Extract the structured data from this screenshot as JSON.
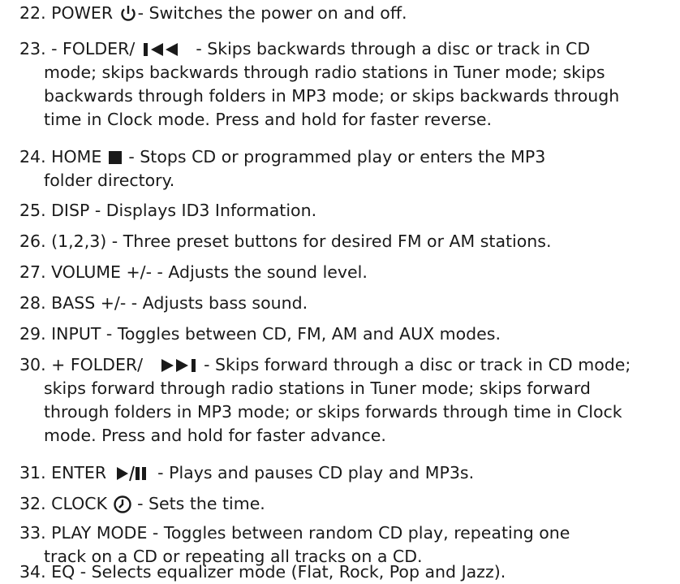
{
  "items": [
    {
      "num": "22.",
      "pre": " POWER ",
      "post": "- Switches the power on and off.",
      "icon": "power-icon"
    },
    {
      "num": "23.",
      "pre": " - FOLDER/ ",
      "post": " - Skips backwards through a disc or track in CD",
      "icon": "skip-back-icon",
      "cont": [
        "mode; skips backwards through radio stations in Tuner mode; skips",
        "backwards through folders in MP3 mode; or skips backwards through",
        "time in Clock mode.  Press and hold for faster reverse."
      ]
    },
    {
      "num": "24.",
      "pre": " HOME ",
      "post": " - Stops CD or programmed play or enters the MP3",
      "icon": "stop-square-icon",
      "cont": [
        "folder directory."
      ]
    },
    {
      "num": "25.",
      "text": " DISP - Displays ID3 Information."
    },
    {
      "num": "26.",
      "text": " (1,2,3) - Three preset buttons for desired FM or AM stations."
    },
    {
      "num": "27.",
      "text": " VOLUME +/- - Adjusts the sound level."
    },
    {
      "num": "28.",
      "text": " BASS +/- - Adjusts bass sound."
    },
    {
      "num": "29.",
      "text": " INPUT - Toggles between CD, FM, AM and AUX modes."
    },
    {
      "num": "30.",
      "pre": " + FOLDER/ ",
      "post": " - Skips forward through a disc or track in CD mode;",
      "icon": "skip-forward-icon",
      "cont": [
        "skips forward through radio stations in Tuner mode; skips forward",
        "through folders in MP3 mode; or skips forwards through time in Clock",
        "mode.  Press and hold for faster advance."
      ]
    },
    {
      "num": "31.",
      "pre": " ENTER ",
      "post": " - Plays and pauses CD play and MP3s.",
      "icon": "play-pause-icon"
    },
    {
      "num": "32.",
      "pre": " CLOCK ",
      "post": " - Sets the time.",
      "icon": "clock-icon"
    },
    {
      "num": "33.",
      "text": " PLAY MODE - Toggles between random CD play, repeating one",
      "cont": [
        "track on a CD or repeating all tracks on a CD."
      ]
    },
    {
      "num": "34.",
      "text": " EQ - Selects equalizer mode (Flat, Rock, Pop and Jazz)."
    }
  ]
}
